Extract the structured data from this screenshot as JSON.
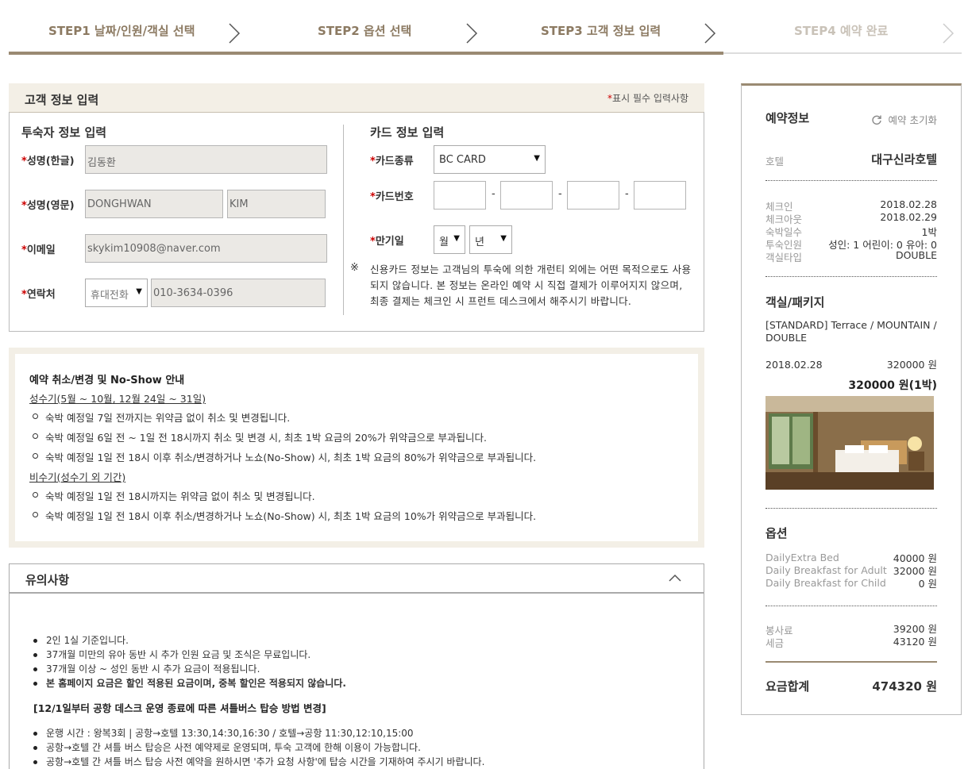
{
  "steps": [
    {
      "label": "STEP1 날짜/인원/객실 선택"
    },
    {
      "label": "STEP2 옵션 선택"
    },
    {
      "label": "STEP3 고객 정보 입력"
    },
    {
      "label": "STEP4 예약 완료"
    }
  ],
  "guest": {
    "title": "고객 정보 입력",
    "required_mark": "*",
    "required_note": "표시 필수 입력사항",
    "guest_section_title": "투숙자 정보 입력",
    "card_section_title": "카드 정보 입력",
    "name_kr_label": "성명(한글)",
    "name_kr_value": "김동환",
    "name_en_label": "성명(영문)",
    "name_en_first": "DONGHWAN",
    "name_en_last": "KIM",
    "email_label": "이메일",
    "email_value": "skykim10908@naver.com",
    "phone_label": "연락처",
    "phone_type": "휴대전화",
    "phone_value": "010-3634-0396",
    "card_type_label": "카드종류",
    "card_type_value": "BC CARD",
    "card_number_label": "카드번호",
    "card_number_sep": "-",
    "expiry_label": "만기일",
    "expiry_month": "월",
    "expiry_year": "년",
    "notice_mark": "※",
    "notice_text": "신용카드 정보는 고객님의 투숙에 의한 개런티 외에는 어떤 목적으로도 사용되지 않습니다. 본 정보는 온라인 예약 시 직접 결제가 이루어지지 않으며, 최종 결제는 체크인 시 프런트 데스크에서 해주시기 바랍니다."
  },
  "cancel": {
    "title": "예약 취소/변경 및 No-Show 안내",
    "peak_title": "성수기(5월 ~ 10월, 12월 24일 ~ 31일)",
    "peak_items": [
      "숙박 예정일 7일 전까지는 위약금 없이 취소 및 변경됩니다.",
      "숙박 예정일 6일 전 ~ 1일 전 18시까지 취소 및 변경 시, 최초 1박 요금의 20%가 위약금으로 부과됩니다.",
      "숙박 예정일 1일 전 18시 이후 취소/변경하거나 노쇼(No-Show) 시, 최초 1박 요금의 80%가 위약금으로 부과됩니다."
    ],
    "offpeak_title": "비수기(성수기 외 기간)",
    "offpeak_items": [
      "숙박 예정일 1일 전 18시까지는 위약금 없이 취소 및 변경됩니다.",
      "숙박 예정일 1일 전 18시 이후 취소/변경하거나 노쇼(No-Show) 시, 최초 1박 요금의 10%가 위약금으로 부과됩니다."
    ]
  },
  "notes": {
    "title": "유의사항",
    "items": [
      "2인 1실 기준입니다.",
      "37개월 미만의 유아 동반 시 추가 인원 요금 및 조식은 무료입니다.",
      "37개월 이상 ~ 성인 동반 시 추가 요금이 적용됩니다.",
      "본 홈페이지 요금은 할인 적용된 요금이며, 중복 할인은 적용되지 않습니다."
    ],
    "shuttle_title": "[12/1일부터 공항 데스크 운영 종료에 따른 셔틀버스 탑승 방법 변경]",
    "shuttle_items": [
      "운행 시간 : 왕복3회 | 공항→호텔 13:30,14:30,16:30 / 호텔→공항 11:30,12:10,15:00",
      "공항→호텔 간 셔틀 버스 탑승은 사전 예약제로 운영되며, 투숙 고객에 한해 이용이 가능합니다.",
      "공항→호텔 간 셔틀 버스 탑승 사전 예약을 원하시면 '추가 요청 사항'에 탑승 시간을 기재하여 주시기 바랍니다."
    ]
  },
  "summary": {
    "title": "예약정보",
    "reset_label": "예약 초기화",
    "hotel_label": "호텔",
    "hotel_name": "대구신라호텔",
    "checkin_label": "체크인",
    "checkin_value": "2018.02.28",
    "checkout_label": "체크아웃",
    "checkout_value": "2018.02.29",
    "nights_label": "숙박일수",
    "nights_value": "1박",
    "guests_label": "투숙인원",
    "guests_value": "성인: 1 어린이: 0 유아: 0",
    "roomtype_label": "객실타입",
    "roomtype_value": "DOUBLE",
    "room_section": "객실/패키지",
    "room_name": "[STANDARD] Terrace / MOUNTAIN / DOUBLE",
    "room_date": "2018.02.28",
    "room_price": "320000 원",
    "room_subtotal": "320000 원(1박)",
    "options_section": "옵션",
    "options": [
      {
        "name": "DailyExtra Bed",
        "price": "40000 원"
      },
      {
        "name": "Daily Breakfast for Adult",
        "price": "32000 원"
      },
      {
        "name": "Daily Breakfast for Child",
        "price": "0 원"
      }
    ],
    "service_label": "봉사료",
    "service_value": "39200 원",
    "tax_label": "세금",
    "tax_value": "43120 원",
    "total_label": "요금합계",
    "total_value": "474320 원"
  }
}
